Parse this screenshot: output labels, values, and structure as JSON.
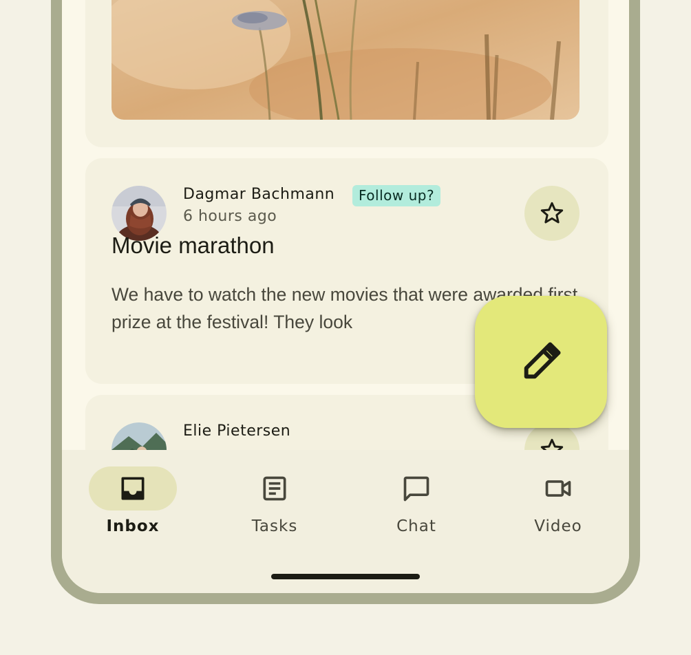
{
  "emails": [
    {
      "sender": "Dagmar Bachmann",
      "time": "6 hours ago",
      "badge": "Follow up?",
      "subject": "Movie marathon",
      "preview": "We have to watch the new movies that were awarded first prize at the festival! They look"
    },
    {
      "sender": "Elie Pietersen"
    }
  ],
  "nav": {
    "items": [
      {
        "label": "Inbox",
        "icon": "inbox-icon",
        "active": true
      },
      {
        "label": "Tasks",
        "icon": "tasks-icon",
        "active": false
      },
      {
        "label": "Chat",
        "icon": "chat-icon",
        "active": false
      },
      {
        "label": "Video",
        "icon": "video-icon",
        "active": false
      }
    ]
  },
  "fab": {
    "icon": "pencil-icon"
  },
  "colors": {
    "frame": "#a9ac8f",
    "surface": "#fbf8ea",
    "card": "#f4f1e0",
    "fab": "#e3e87a",
    "badge": "#b2ecdc",
    "star_button": "#e6e5bf",
    "nav_active": "#e5e3b9"
  }
}
